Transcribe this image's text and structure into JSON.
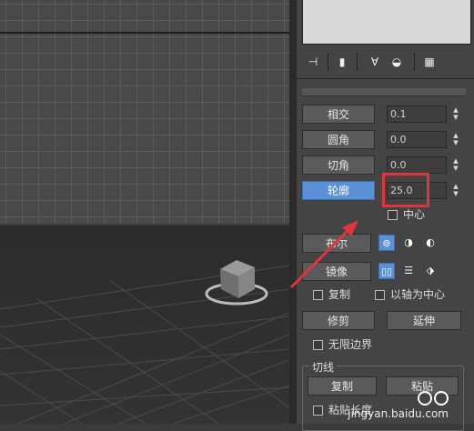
{
  "toolbar": {
    "icons": [
      "pin-icon",
      "modifier-stack-icon",
      "funnel-icon",
      "lock-icon",
      "configure-icon"
    ]
  },
  "spline": {
    "intersect": {
      "label": "相交",
      "value": "0.1"
    },
    "fillet": {
      "label": "圆角",
      "value": "0.0"
    },
    "chamfer": {
      "label": "切角",
      "value": "0.0"
    },
    "outline": {
      "label": "轮廓",
      "value": "25.0"
    },
    "center_label": "中心",
    "boolean_label": "布尔",
    "mirror_label": "镜像",
    "copy_label": "复制",
    "about_pivot_label": "以轴为中心",
    "trim_label": "修剪",
    "extend_label": "延伸",
    "infinite_bounds_label": "无限边界",
    "tangent_group_label": "切线",
    "tangent_copy_label": "复制",
    "tangent_paste_label": "粘贴",
    "paste_length_label": "粘贴长度"
  },
  "watermark": "jingyan.baidu.com",
  "colors": {
    "active_button": "#5b8fd6",
    "highlight_border": "#e0353d",
    "arrow": "#e0353d"
  }
}
